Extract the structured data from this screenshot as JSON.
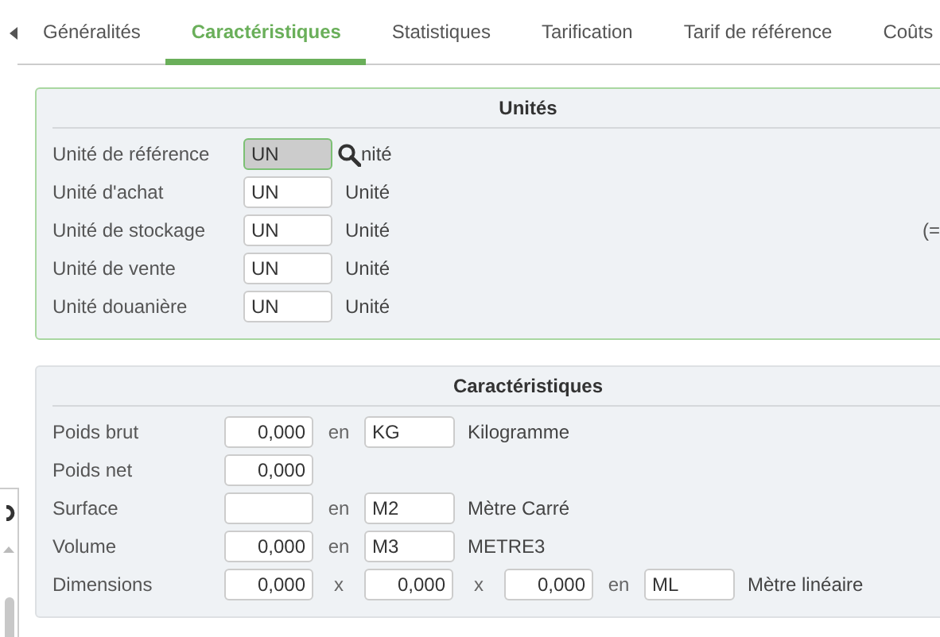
{
  "tabs": [
    {
      "label": "Généralités",
      "selected": false
    },
    {
      "label": "Caractéristiques",
      "selected": true
    },
    {
      "label": "Statistiques",
      "selected": false
    },
    {
      "label": "Tarification",
      "selected": false
    },
    {
      "label": "Tarif de référence",
      "selected": false
    },
    {
      "label": "Coûts",
      "selected": false
    }
  ],
  "units": {
    "title": "Unités",
    "rows": [
      {
        "label": "Unité de référence",
        "code": "UN",
        "unit_name": "nité",
        "focused": true
      },
      {
        "label": "Unité d'achat",
        "code": "UN",
        "unit_name": "Unité",
        "focused": false
      },
      {
        "label": "Unité de stockage",
        "code": "UN",
        "unit_name": "Unité",
        "focused": false,
        "note": "(="
      },
      {
        "label": "Unité de vente",
        "code": "UN",
        "unit_name": "Unité",
        "focused": false
      },
      {
        "label": "Unité douanière",
        "code": "UN",
        "unit_name": "Unité",
        "focused": false
      }
    ]
  },
  "characteristics": {
    "title": "Caractéristiques",
    "rows": [
      {
        "label": "Poids brut",
        "items": [
          {
            "kind": "number",
            "value": "0,000"
          },
          {
            "kind": "sep",
            "text": "en"
          },
          {
            "kind": "code",
            "value": "KG"
          },
          {
            "kind": "text",
            "text": "Kilogramme"
          }
        ]
      },
      {
        "label": "Poids net",
        "items": [
          {
            "kind": "number",
            "value": "0,000"
          }
        ]
      },
      {
        "label": "Surface",
        "items": [
          {
            "kind": "number"
          },
          {
            "kind": "sep",
            "text": "en"
          },
          {
            "kind": "code",
            "value": "M2"
          },
          {
            "kind": "text",
            "text": "Mètre Carré"
          }
        ]
      },
      {
        "label": "Volume",
        "items": [
          {
            "kind": "number",
            "value": "0,000"
          },
          {
            "kind": "sep",
            "text": "en"
          },
          {
            "kind": "code",
            "value": "M3"
          },
          {
            "kind": "text",
            "text": "METRE3"
          }
        ]
      },
      {
        "label": "Dimensions",
        "items": [
          {
            "kind": "number",
            "value": "0,000"
          },
          {
            "kind": "sep",
            "text": "x"
          },
          {
            "kind": "number",
            "value": "0,000"
          },
          {
            "kind": "sep",
            "text": "x"
          },
          {
            "kind": "number",
            "value": "0,000"
          },
          {
            "kind": "sep",
            "text": "en"
          },
          {
            "kind": "code",
            "value": "ML"
          },
          {
            "kind": "text",
            "text": "Mètre linéaire"
          }
        ]
      }
    ]
  }
}
